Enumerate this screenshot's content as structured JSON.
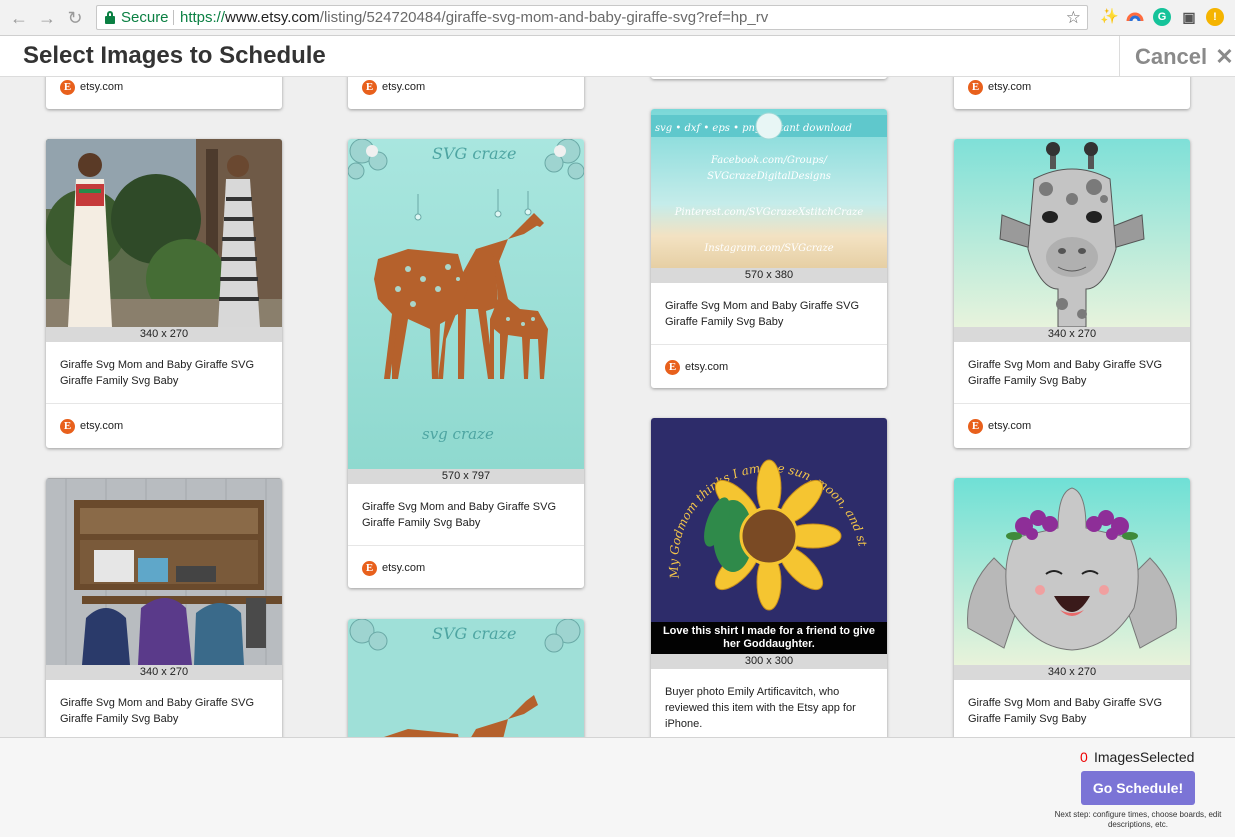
{
  "browser": {
    "secure_label": "Secure",
    "url_scheme": "https://",
    "url_host": "www.etsy.com",
    "url_path": "/listing/524720484/giraffe-svg-mom-and-baby-giraffe-svg?ref=hp_rv"
  },
  "modal": {
    "title": "Select Images to Schedule",
    "cancel_label": "Cancel"
  },
  "cards": {
    "c0": {
      "source": "etsy.com"
    },
    "c1": {
      "source": "etsy.com"
    },
    "c3": {
      "source": "etsy.com"
    },
    "woman": {
      "dimensions": "340 x 270",
      "title_line1": "Giraffe Svg Mom and Baby Giraffe SVG",
      "title_line2": "Giraffe Family Svg Baby",
      "source": "etsy.com"
    },
    "giraffes": {
      "dimensions": "570 x 797",
      "title_line1": "Giraffe Svg Mom and Baby Giraffe SVG",
      "title_line2": "Giraffe Family Svg Baby",
      "source": "etsy.com",
      "brand_top": "SVG craze",
      "brand_bottom": "svg craze"
    },
    "social": {
      "dimensions": "570 x 380",
      "title_line1": "Giraffe Svg Mom and Baby Giraffe SVG",
      "title_line2": "Giraffe Family Svg Baby",
      "source": "etsy.com",
      "banner": "svg • dxf • eps • png     instant download",
      "line1": "Facebook.com/Groups/",
      "line2": "SVGcrazeDigitalDesigns",
      "line3": "Pinterest.com/SVGcrazeXstitchCraze",
      "line4": "Instagram.com/SVGcraze"
    },
    "giraffe_face": {
      "dimensions": "340 x 270",
      "title_line1": "Giraffe Svg Mom and Baby Giraffe SVG",
      "title_line2": "Giraffe Family Svg Baby",
      "source": "etsy.com"
    },
    "shelf": {
      "dimensions": "340 x 270",
      "title_line1": "Giraffe Svg Mom and Baby Giraffe SVG",
      "title_line2": "Giraffe Family Svg Baby"
    },
    "sunflower": {
      "dimensions": "300 x 300",
      "shirt_text": "My Godmom thinks I am the sun, moon, and stars",
      "photo_caption": "Love this shirt I made for a friend to give her Goddaughter.",
      "title_line1": "Buyer photo Emily Artificavitch, who",
      "title_line2": "reviewed this item with the Etsy app for",
      "title_line3": "iPhone."
    },
    "elephant": {
      "dimensions": "340 x 270",
      "title_line1": "Giraffe Svg Mom and Baby Giraffe SVG",
      "title_line2": "Giraffe Family Svg Baby"
    },
    "giraffes2": {
      "brand_top": "SVG craze"
    }
  },
  "footer": {
    "count": "0",
    "count_label": "ImagesSelected",
    "go_label": "Go Schedule!",
    "next_step": "Next step: configure times, choose boards, edit descriptions, etc."
  },
  "colors": {
    "etsy_orange": "#e8601c",
    "go_button": "#7b74d6",
    "secure_green": "#0b8043",
    "count_red": "#e00000"
  }
}
